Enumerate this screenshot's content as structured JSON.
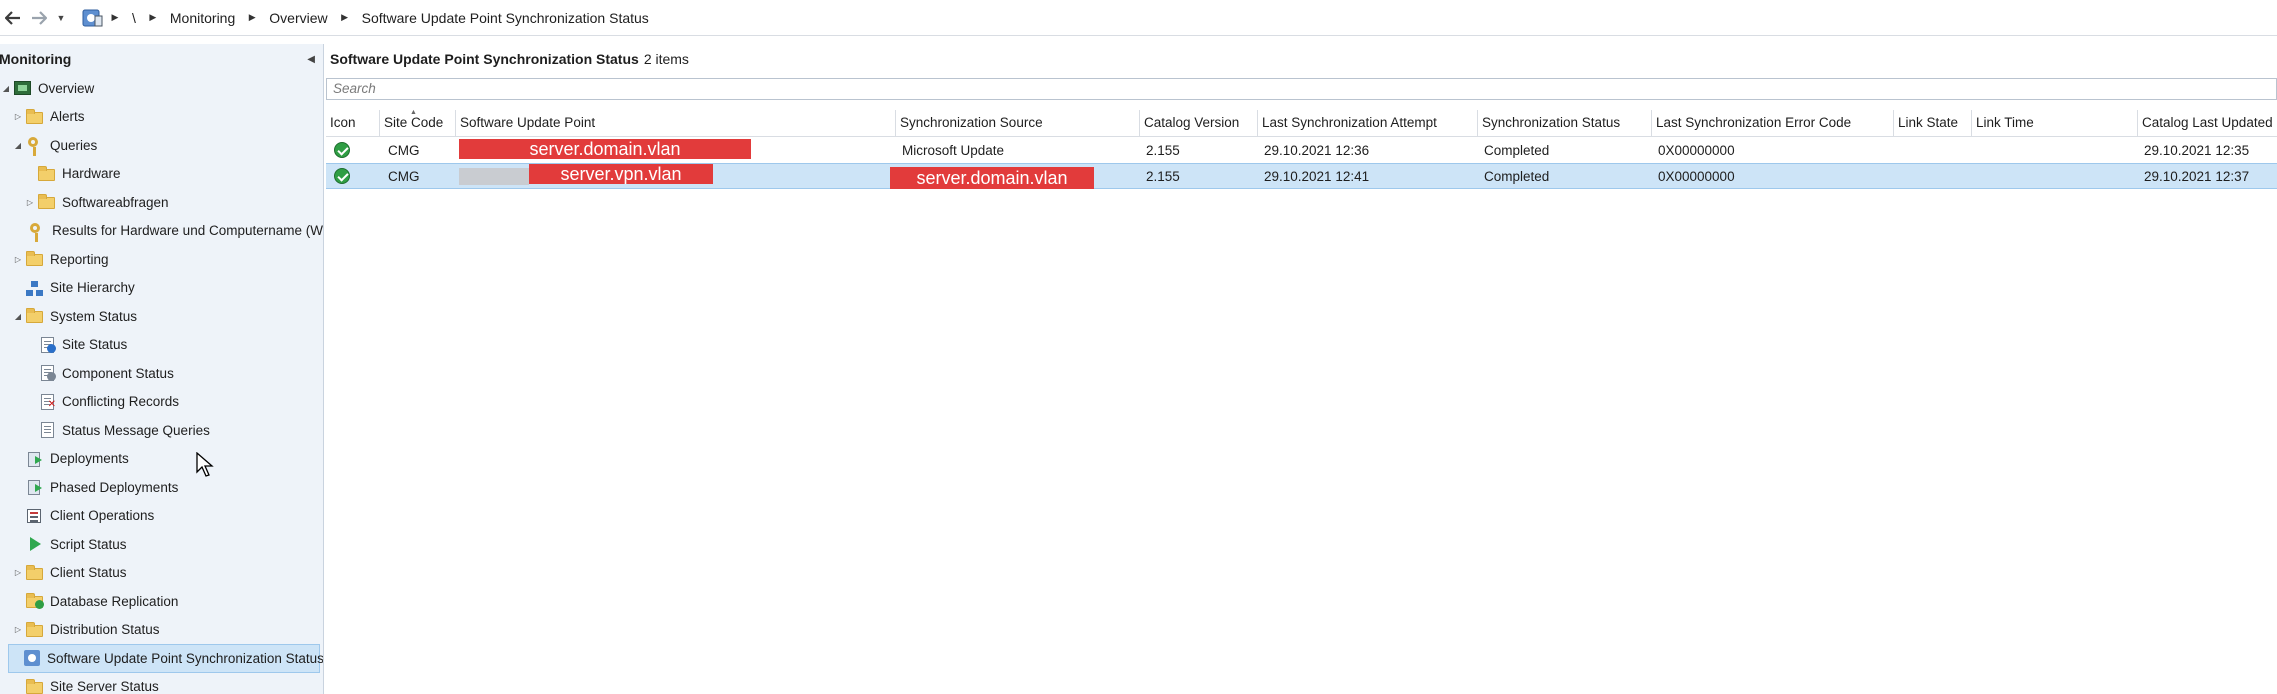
{
  "breadcrumb": {
    "back_icon": "arrow-left",
    "forward_icon": "arrow-right",
    "root": "\\",
    "items": [
      "Monitoring",
      "Overview",
      "Software Update Point Synchronization Status"
    ]
  },
  "nav": {
    "title": "Monitoring",
    "items": [
      {
        "label": "Overview",
        "icon": "overview-icon"
      },
      {
        "label": "Alerts",
        "icon": "folder-icon"
      },
      {
        "label": "Queries",
        "icon": "key-icon"
      },
      {
        "label": "Hardware",
        "icon": "folder-icon"
      },
      {
        "label": "Softwareabfragen",
        "icon": "folder-icon"
      },
      {
        "label": "Results for Hardware und Computername (W",
        "icon": "key-icon"
      },
      {
        "label": "Reporting",
        "icon": "folder-icon"
      },
      {
        "label": "Site Hierarchy",
        "icon": "hierarchy-icon"
      },
      {
        "label": "System Status",
        "icon": "folder-icon"
      },
      {
        "label": "Site Status",
        "icon": "site-status-icon"
      },
      {
        "label": "Component Status",
        "icon": "component-status-icon"
      },
      {
        "label": "Conflicting Records",
        "icon": "conflicting-records-icon"
      },
      {
        "label": "Status Message Queries",
        "icon": "status-message-queries-icon"
      },
      {
        "label": "Deployments",
        "icon": "deployments-icon"
      },
      {
        "label": "Phased Deployments",
        "icon": "phased-deployments-icon"
      },
      {
        "label": "Client Operations",
        "icon": "client-operations-icon"
      },
      {
        "label": "Script Status",
        "icon": "script-status-icon"
      },
      {
        "label": "Client Status",
        "icon": "folder-icon"
      },
      {
        "label": "Database Replication",
        "icon": "database-replication-icon"
      },
      {
        "label": "Distribution Status",
        "icon": "folder-icon"
      },
      {
        "label": "Software Update Point Synchronization Status",
        "icon": "sup-sync-icon"
      },
      {
        "label": "Site Server Status",
        "icon": "folder-icon"
      }
    ]
  },
  "main": {
    "title": "Software Update Point Synchronization Status",
    "count": "2 items",
    "search_placeholder": "Search",
    "columns": [
      "Icon",
      "Site Code",
      "Software Update Point",
      "Synchronization Source",
      "Catalog Version",
      "Last Synchronization Attempt",
      "Synchronization Status",
      "Last Synchronization Error Code",
      "Link State",
      "Link Time",
      "Catalog Last Updated"
    ],
    "rows": [
      {
        "site_code": "CMG",
        "sup": "server.domain.vlan",
        "source": "Microsoft Update",
        "catalog_version": "2.155",
        "last_attempt": "29.10.2021 12:36",
        "status": "Completed",
        "error_code": "0X00000000",
        "link_state": "",
        "link_time": "",
        "catalog_updated": "29.10.2021 12:35"
      },
      {
        "site_code": "CMG",
        "sup": "server.vpn.vlan",
        "source": "server.domain.vlan",
        "catalog_version": "2.155",
        "last_attempt": "29.10.2021 12:41",
        "status": "Completed",
        "error_code": "0X00000000",
        "link_state": "",
        "link_time": "",
        "catalog_updated": "29.10.2021 12:37"
      }
    ]
  },
  "colors": {
    "redaction": "#e23b3b",
    "selection": "#cde4f7",
    "nav_background": "#eef3f9"
  }
}
